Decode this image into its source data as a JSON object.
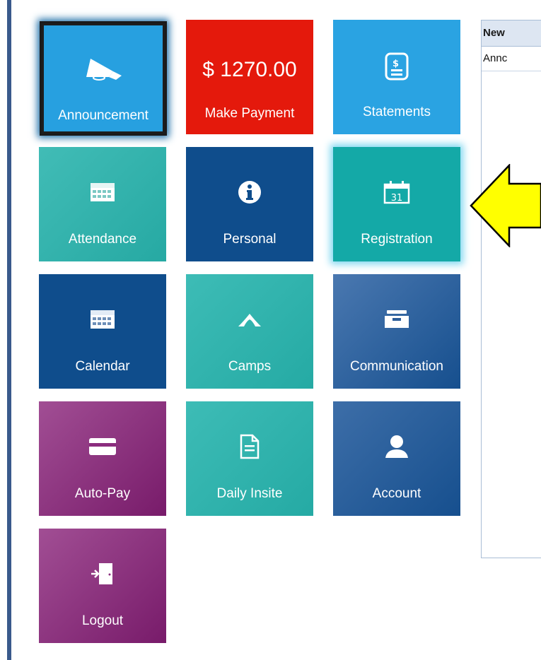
{
  "tiles": {
    "announcement": {
      "label": "Announcement",
      "icon": "megaphone-icon"
    },
    "payment": {
      "amount": "$ 1270.00",
      "label": "Make Payment"
    },
    "statements": {
      "label": "Statements",
      "icon": "statement-document-icon"
    },
    "attendance": {
      "label": "Attendance",
      "icon": "calendar-grid-icon"
    },
    "personal": {
      "label": "Personal",
      "icon": "info-icon"
    },
    "registration": {
      "label": "Registration",
      "icon": "calendar-31-icon",
      "badge": "31"
    },
    "calendar": {
      "label": "Calendar",
      "icon": "calendar-grid-icon"
    },
    "camps": {
      "label": "Camps",
      "icon": "tent-icon"
    },
    "communication": {
      "label": "Communication",
      "icon": "inbox-tray-icon"
    },
    "autopay": {
      "label": "Auto-Pay",
      "icon": "credit-card-icon"
    },
    "daily": {
      "label": "Daily Insite",
      "icon": "document-icon"
    },
    "account": {
      "label": "Account",
      "icon": "user-icon"
    },
    "logout": {
      "label": "Logout",
      "icon": "door-exit-icon"
    }
  },
  "news": {
    "header": "New",
    "row": "Annc"
  },
  "colors": {
    "red": "#e4190c",
    "light_blue": "#2aa3e2",
    "teal": "#14a9a7",
    "navy": "#0f4d8c",
    "purple": "#8a2f7d",
    "arrow_yellow": "#ffff00"
  }
}
